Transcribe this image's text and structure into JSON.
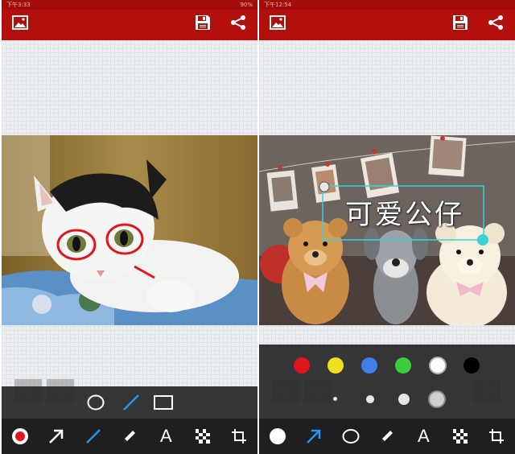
{
  "colors": {
    "brand": "#b30f0c",
    "status": "#a40d0a",
    "toolbar": "#1f1f21",
    "accent": "#2196f3",
    "drawing_red": "#e0161c",
    "text_box": "#38d2d8"
  },
  "left_screen": {
    "status": {
      "left": "下午3:33",
      "right": "90%"
    },
    "appbar_icons": [
      "image-icon",
      "save-icon",
      "share-icon"
    ],
    "shape_options": [
      "circle-shape-icon",
      "line-shape-icon",
      "rectangle-shape-icon"
    ],
    "tools": [
      "color-dot-icon",
      "arrow-tool-icon",
      "line-tool-icon",
      "pencil-tool-icon",
      "text-tool-icon",
      "mosaic-tool-icon",
      "crop-tool-icon"
    ],
    "text_tool_label": "A"
  },
  "right_screen": {
    "status": {
      "left": "下午12:54",
      "right": ""
    },
    "appbar_icons": [
      "image-icon",
      "save-icon",
      "share-icon"
    ],
    "palette": [
      "#e0161c",
      "#f0e020",
      "#3f7ee8",
      "#3ccc3c",
      "#ffffff",
      "#000000"
    ],
    "sizes": [
      "size-xs",
      "size-s",
      "size-m",
      "size-l"
    ],
    "tools": [
      "color-dot-icon",
      "arrow-tool-icon",
      "circle-tool-icon",
      "pencil-tool-icon",
      "text-tool-icon",
      "mosaic-tool-icon",
      "crop-tool-icon"
    ],
    "text_tool_label": "A",
    "annotation_text": "可爱公仔"
  }
}
